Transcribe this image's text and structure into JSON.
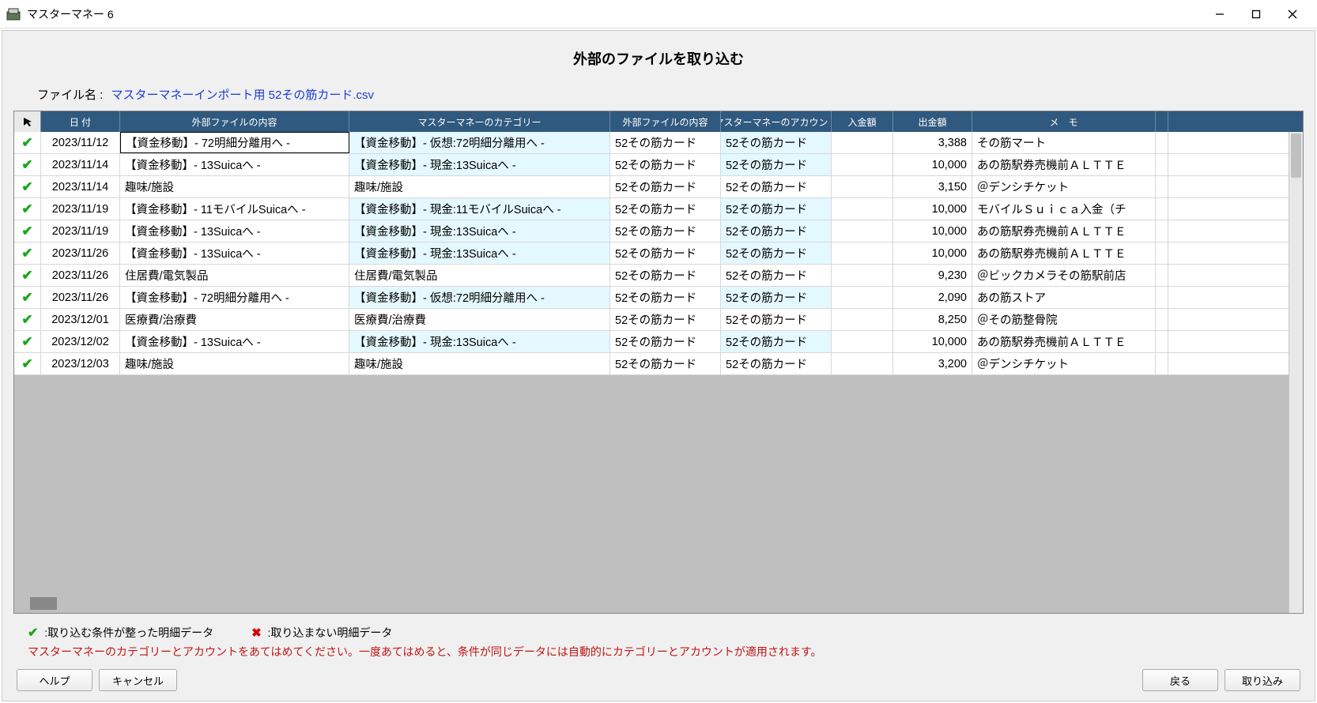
{
  "window": {
    "title": "マスターマネー 6"
  },
  "dialog": {
    "title": "外部のファイルを取り込む",
    "file_label": "ファイル名 :",
    "file_name": "マスターマネーインポート用 52その筋カード.csv"
  },
  "columns": {
    "date": "日 付",
    "ext_content": "外部ファイルの内容",
    "mm_category": "マスターマネーのカテゴリー",
    "ext_acct": "外部ファイルの内容",
    "mm_acct": "マスターマネーのアカウント",
    "in_amt": "入金額",
    "out_amt": "出金額",
    "memo": "メ　モ"
  },
  "rows": [
    {
      "chk": true,
      "date": "2023/11/12",
      "ext": "【資金移動】- 72明細分離用へ -",
      "cat": "【資金移動】- 仮想:72明細分離用へ -",
      "cat_hl": true,
      "sel": true,
      "eacct": "52その筋カード",
      "macct": "52その筋カード",
      "macct_hl": true,
      "in": "",
      "out": "3,388",
      "memo": "その筋マート"
    },
    {
      "chk": true,
      "date": "2023/11/14",
      "ext": "【資金移動】- 13Suicaへ -",
      "cat": "【資金移動】- 現金:13Suicaへ -",
      "cat_hl": true,
      "eacct": "52その筋カード",
      "macct": "52その筋カード",
      "macct_hl": true,
      "in": "",
      "out": "10,000",
      "memo": "あの筋駅券売機前ＡＬＴＴＥ"
    },
    {
      "chk": true,
      "date": "2023/11/14",
      "ext": "趣味/施設",
      "cat": "趣味/施設",
      "eacct": "52その筋カード",
      "macct": "52その筋カード",
      "in": "",
      "out": "3,150",
      "memo": "＠デンシチケット"
    },
    {
      "chk": true,
      "date": "2023/11/19",
      "ext": "【資金移動】- 11モバイルSuicaへ -",
      "cat": "【資金移動】- 現金:11モバイルSuicaへ -",
      "cat_hl": true,
      "eacct": "52その筋カード",
      "macct": "52その筋カード",
      "macct_hl": true,
      "in": "",
      "out": "10,000",
      "memo": "モバイルＳｕｉｃａ入金（チ"
    },
    {
      "chk": true,
      "date": "2023/11/19",
      "ext": "【資金移動】- 13Suicaへ -",
      "cat": "【資金移動】- 現金:13Suicaへ -",
      "cat_hl": true,
      "eacct": "52その筋カード",
      "macct": "52その筋カード",
      "macct_hl": true,
      "in": "",
      "out": "10,000",
      "memo": "あの筋駅券売機前ＡＬＴＴＥ"
    },
    {
      "chk": true,
      "date": "2023/11/26",
      "ext": "【資金移動】- 13Suicaへ -",
      "cat": "【資金移動】- 現金:13Suicaへ -",
      "cat_hl": true,
      "eacct": "52その筋カード",
      "macct": "52その筋カード",
      "macct_hl": true,
      "in": "",
      "out": "10,000",
      "memo": "あの筋駅券売機前ＡＬＴＴＥ"
    },
    {
      "chk": true,
      "date": "2023/11/26",
      "ext": "住居費/電気製品",
      "cat": "住居費/電気製品",
      "eacct": "52その筋カード",
      "macct": "52その筋カード",
      "in": "",
      "out": "9,230",
      "memo": "＠ビックカメラその筋駅前店"
    },
    {
      "chk": true,
      "date": "2023/11/26",
      "ext": "【資金移動】- 72明細分離用へ -",
      "cat": "【資金移動】- 仮想:72明細分離用へ -",
      "cat_hl": true,
      "eacct": "52その筋カード",
      "macct": "52その筋カード",
      "macct_hl": true,
      "in": "",
      "out": "2,090",
      "memo": "あの筋ストア"
    },
    {
      "chk": true,
      "date": "2023/12/01",
      "ext": "医療費/治療費",
      "cat": "医療費/治療費",
      "eacct": "52その筋カード",
      "macct": "52その筋カード",
      "in": "",
      "out": "8,250",
      "memo": "＠その筋整骨院"
    },
    {
      "chk": true,
      "date": "2023/12/02",
      "ext": "【資金移動】- 13Suicaへ -",
      "cat": "【資金移動】- 現金:13Suicaへ -",
      "cat_hl": true,
      "eacct": "52その筋カード",
      "macct": "52その筋カード",
      "macct_hl": true,
      "in": "",
      "out": "10,000",
      "memo": "あの筋駅券売機前ＡＬＴＴＥ"
    },
    {
      "chk": true,
      "date": "2023/12/03",
      "ext": "趣味/施設",
      "cat": "趣味/施設",
      "eacct": "52その筋カード",
      "macct": "52その筋カード",
      "in": "",
      "out": "3,200",
      "memo": "＠デンシチケット"
    }
  ],
  "legend": {
    "ok": ":取り込む条件が整った明細データ",
    "ng": ":取り込まない明細データ",
    "hint": "マスターマネーのカテゴリーとアカウントをあてはめてください。一度あてはめると、条件が同じデータには自動的にカテゴリーとアカウントが適用されます。"
  },
  "buttons": {
    "help": "ヘルプ",
    "cancel": "キャンセル",
    "back": "戻る",
    "import": "取り込み"
  }
}
